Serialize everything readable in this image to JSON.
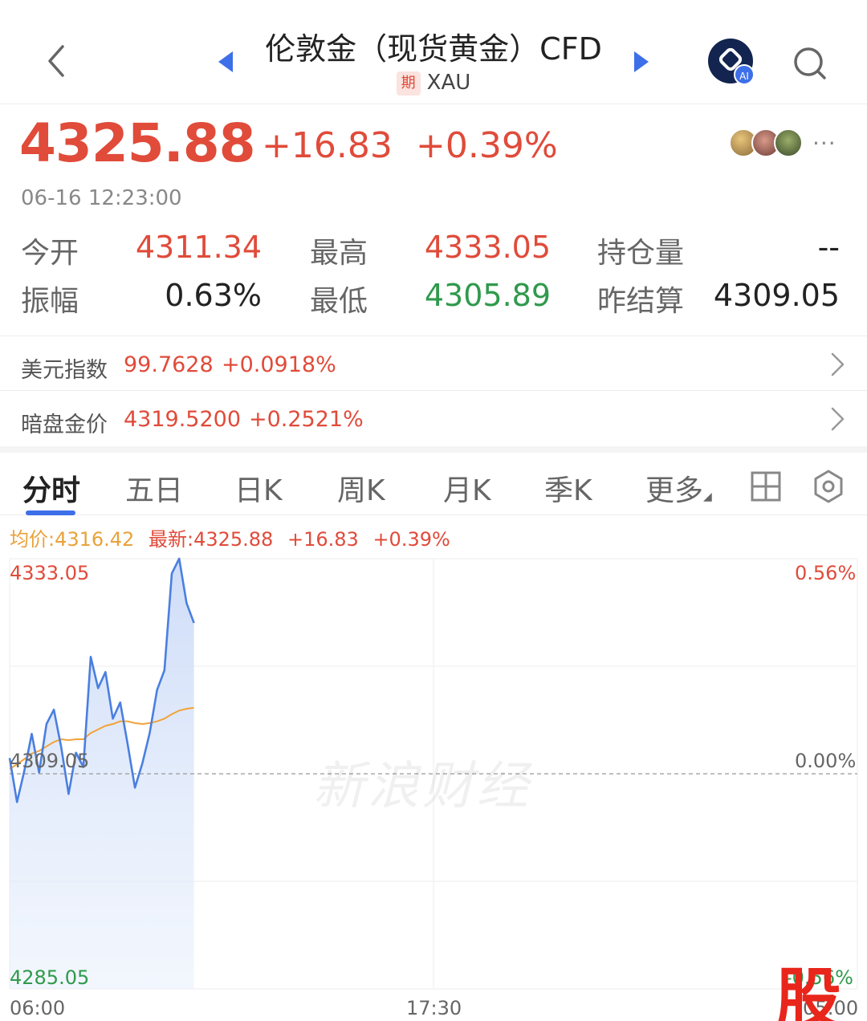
{
  "header": {
    "title": "伦敦金（现货黄金）CFD",
    "badge": "期",
    "subtitle": "XAU",
    "ai_label": "AI"
  },
  "quote": {
    "price": "4325.88",
    "change": "+16.83",
    "change_pct": "+0.39%",
    "timestamp": "06-16 12:23:00",
    "more": "···"
  },
  "stats": {
    "open_label": "今开",
    "open_value": "4311.34",
    "high_label": "最高",
    "high_value": "4333.05",
    "oi_label": "持仓量",
    "oi_value": "--",
    "amp_label": "振幅",
    "amp_value": "0.63%",
    "low_label": "最低",
    "low_value": "4305.89",
    "prev_label": "昨结算",
    "prev_value": "4309.05"
  },
  "related": [
    {
      "label": "美元指数",
      "value": "99.7628",
      "change": "+0.0918%"
    },
    {
      "label": "暗盘金价",
      "value": "4319.5200",
      "change": "+0.2521%"
    }
  ],
  "tabs": [
    "分时",
    "五日",
    "日K",
    "周K",
    "月K",
    "季K",
    "更多"
  ],
  "active_tab": 0,
  "chart_info": {
    "avg": "均价:4316.42",
    "latest": "最新:4325.88",
    "change": "+16.83",
    "change_pct": "+0.39%"
  },
  "colors": {
    "up": "#e04b3a",
    "down": "#2f9a4c",
    "price_line": "#4a7fe0",
    "avg_line": "#f2a23a",
    "accent": "#3d6fe8"
  },
  "chart_data": {
    "type": "line",
    "title": "",
    "xlabel": "",
    "ylabel": "",
    "x_ticks": [
      "06:00",
      "17:30",
      "05:00"
    ],
    "y_ticks_left": [
      "4333.05",
      "4309.05",
      "4285.05"
    ],
    "y_ticks_right": [
      "0.56%",
      "0.00%",
      "-0.56%"
    ],
    "ylim": [
      4285.05,
      4333.05
    ],
    "reference": 4309.05,
    "x_minutes_since_06_00": [
      0,
      12,
      24,
      36,
      48,
      60,
      72,
      84,
      96,
      108,
      120,
      132,
      144,
      156,
      168,
      180,
      192,
      204,
      216,
      228,
      240,
      252,
      264,
      276,
      288,
      300,
      312,
      324,
      336,
      348,
      360,
      372,
      384,
      396
    ],
    "series": [
      {
        "name": "最新",
        "values": [
          4310.8,
          4305.9,
          4309.4,
          4313.5,
          4309.2,
          4314.6,
          4316.2,
          4312.0,
          4306.8,
          4311.4,
          4309.8,
          4322.1,
          4318.6,
          4320.4,
          4315.2,
          4317.0,
          4312.4,
          4307.5,
          4310.2,
          4313.6,
          4318.4,
          4320.6,
          4331.4,
          4333.05,
          4328.1,
          4325.88
        ]
      },
      {
        "name": "均价",
        "values": [
          4309.6,
          4310.1,
          4310.7,
          4311.3,
          4311.6,
          4312.1,
          4312.6,
          4312.9,
          4312.8,
          4312.9,
          4312.9,
          4313.6,
          4314.0,
          4314.4,
          4314.6,
          4314.9,
          4314.9,
          4314.7,
          4314.6,
          4314.7,
          4314.9,
          4315.2,
          4315.7,
          4316.1,
          4316.3,
          4316.42
        ]
      }
    ]
  },
  "watermark": "新浪财经",
  "logo_text": "股"
}
